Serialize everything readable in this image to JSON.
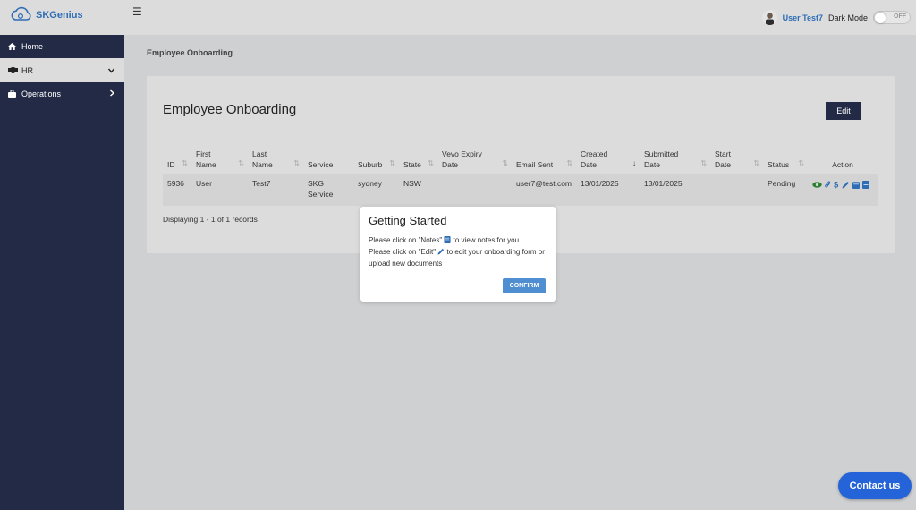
{
  "app": {
    "brand": "SKGenius"
  },
  "topbar": {
    "user_name": "User Test7",
    "dark_mode_label": "Dark Mode",
    "toggle_text": "OFF"
  },
  "sidebar": {
    "items": [
      {
        "label": "Home",
        "icon": "home-icon"
      },
      {
        "label": "HR",
        "icon": "handshake-icon",
        "active": true
      },
      {
        "label": "Operations",
        "icon": "briefcase-icon"
      }
    ]
  },
  "main": {
    "breadcrumb": "Employee Onboarding",
    "card_title": "Employee Onboarding",
    "edit_label": "Edit",
    "columns": [
      "ID",
      "First Name",
      "Last Name",
      "Service",
      "Suburb",
      "State",
      "Vevo Expiry Date",
      "Email Sent",
      "Created Date",
      "Submitted Date",
      "Start Date",
      "Status",
      "Action"
    ],
    "rows": [
      {
        "id": "5936",
        "first_name": "User",
        "last_name": "Test7",
        "service": "SKG Service",
        "suburb": "sydney",
        "state": "NSW",
        "vevo_expiry": "",
        "email_sent": "user7@test.com",
        "created": "13/01/2025",
        "submitted": "13/01/2025",
        "start": "",
        "status": "Pending"
      }
    ],
    "footer": "Displaying 1 - 1 of 1 records"
  },
  "modal": {
    "title": "Getting Started",
    "line1_a": "Please click on \"Notes\"",
    "line1_b": "to view notes for you.",
    "line2_a": "Please click on \"Edit\"",
    "line2_b": "to edit your onboarding form or upload new documents",
    "confirm_label": "CONFIRM"
  },
  "contact": {
    "label": "Contact us"
  },
  "colors": {
    "sidebar": "#222a45",
    "accent": "#2e6db4",
    "confirm": "#4f8ed1",
    "contact": "#2563d8"
  }
}
